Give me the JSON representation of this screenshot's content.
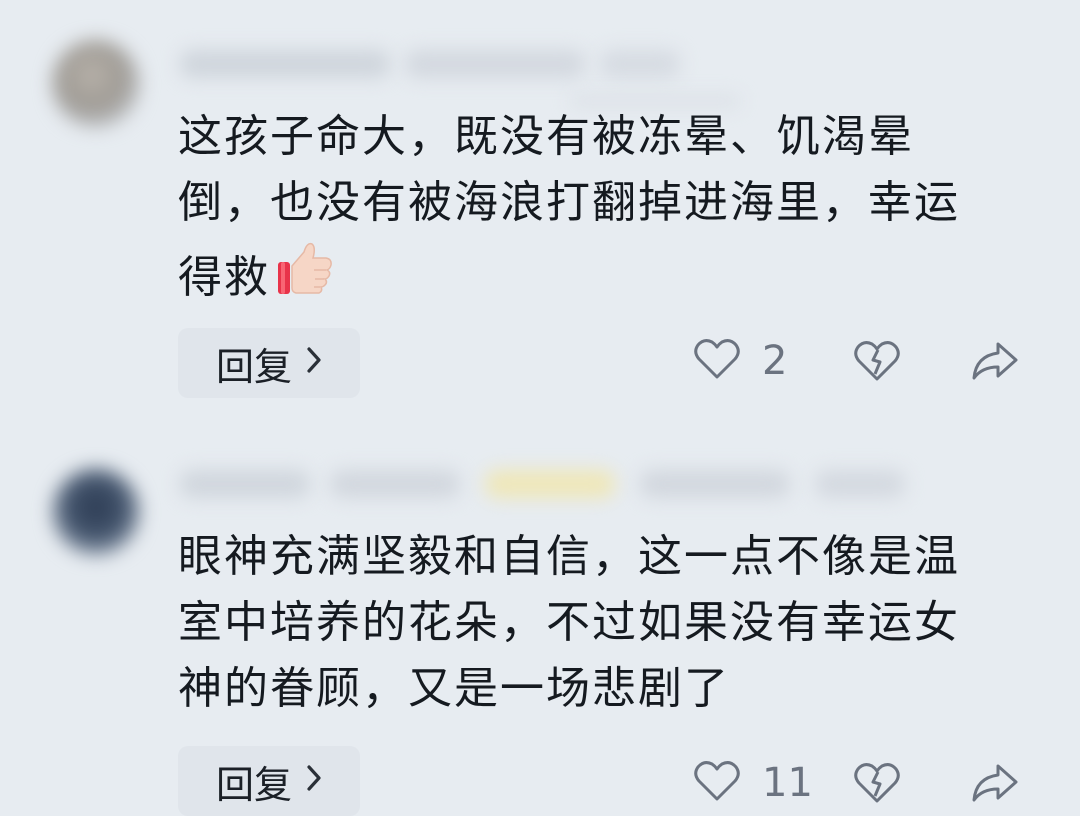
{
  "comments": [
    {
      "text": "这孩子命大，既没有被冻晕、饥渴晕\n倒，也没有被海浪打翻掉进海里，幸运\n得救",
      "emoji": "thumbs-up-icon",
      "reply_label": "回复",
      "like_count": "2"
    },
    {
      "text": "眼神充满坚毅和自信，这一点不像是温\n室中培养的花朵，不过如果没有幸运女\n神的眷顾，又是一场悲剧了",
      "reply_label": "回复",
      "like_count": "11"
    }
  ],
  "colors": {
    "background": "#e7ecf1",
    "text": "#151a20",
    "icon": "#6b7380",
    "reply_bg": "#e0e5eb"
  }
}
